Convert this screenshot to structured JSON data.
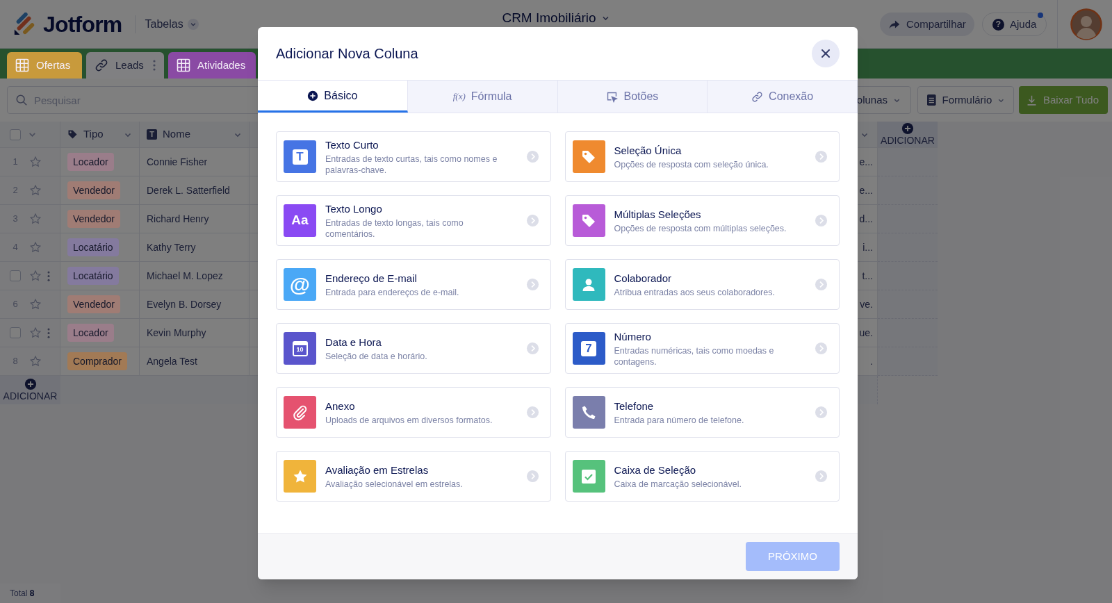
{
  "header": {
    "logo_text": "Jotform",
    "menu": "Tabelas",
    "title": "CRM Imobiliário",
    "share_button": "Compartilhar",
    "help_button": "Ajuda",
    "help_notification": true,
    "help_icon_text": "?"
  },
  "sheet_tabs": [
    {
      "label": "Ofertas",
      "color": "#c89a3c",
      "selected": false,
      "menu": false
    },
    {
      "label": "Leads",
      "color": "#808082",
      "selected": true,
      "menu": true
    },
    {
      "label": "Atividades",
      "color": "#8a4aa4",
      "selected": false,
      "menu": false
    }
  ],
  "toolbar": {
    "search": {
      "placeholder": "Pesquisar"
    },
    "buttons": [
      {
        "label": "olunas",
        "kind": "dropdown"
      },
      {
        "label": "Formulário",
        "kind": "form"
      },
      {
        "label": "Baixar Tudo",
        "kind": "download"
      }
    ]
  },
  "table": {
    "select_all_checked": false,
    "columns": [
      {
        "label": "Tipo",
        "kind": "tag"
      },
      {
        "label": "Nome",
        "kind": "text",
        "icon_text": "T"
      }
    ],
    "add_column": "ADICIONAR",
    "add_row": "ADICIONAR",
    "rows": [
      {
        "kind": "number",
        "number": "1",
        "starred": false,
        "tipo": {
          "label": "Locador",
          "color": "#9a7d8a"
        },
        "nome": "Connie Fisher",
        "column_4": "e..."
      },
      {
        "kind": "number",
        "number": "2",
        "starred": false,
        "tipo": {
          "label": "Vendedor",
          "color": "#a07c74"
        },
        "nome": "Derek L. Satterfield",
        "column_4": "e..."
      },
      {
        "kind": "number",
        "number": "3",
        "starred": false,
        "tipo": {
          "label": "Vendedor",
          "color": "#a07c74"
        },
        "nome": "Richard Henry",
        "column_4": "d..."
      },
      {
        "kind": "number",
        "number": "4",
        "starred": false,
        "tipo": {
          "label": "Locatário",
          "color": "#847a9e"
        },
        "nome": "Kathy Terry",
        "column_4": "i..."
      },
      {
        "kind": "checkbox",
        "checked": false,
        "starred": false,
        "tipo": {
          "label": "Locatário",
          "color": "#847a9e"
        },
        "nome": "Michael M. Lopez",
        "column_4": "t..."
      },
      {
        "kind": "number",
        "number": "6",
        "starred": false,
        "tipo": {
          "label": "Vendedor",
          "color": "#a07c74"
        },
        "nome": "Evelyn B. Dorsey",
        "column_4": "ve."
      },
      {
        "kind": "checkbox",
        "checked": false,
        "starred": false,
        "tipo": {
          "label": "Locador",
          "color": "#9a7d8a"
        },
        "nome": "Kevin Murphy",
        "column_4": "ue."
      },
      {
        "kind": "number",
        "number": "8",
        "starred": false,
        "tipo": {
          "label": "Comprador",
          "color": "#a27a55"
        },
        "nome": "Angela Test",
        "column_4": "."
      }
    ]
  },
  "footer": {
    "label": "Total",
    "count": "8"
  },
  "modal": {
    "title": "Adicionar Nova Coluna",
    "tabs": [
      {
        "label": "Básico",
        "selected": true
      },
      {
        "label": "Fórmula",
        "selected": false,
        "icon_text": "f(x)"
      },
      {
        "label": "Botões",
        "selected": false
      },
      {
        "label": "Conexão",
        "selected": false
      }
    ],
    "fields": [
      {
        "title": "Texto Curto",
        "description": "Entradas de texto curtas, tais como nomes e palavras-chave.",
        "color": "#4674e4",
        "icon_text": "T"
      },
      {
        "title": "Seleção Única",
        "description": "Opções de resposta com seleção única.",
        "color": "#ef8a2f"
      },
      {
        "title": "Texto Longo",
        "description": "Entradas de texto longas, tais como comentários.",
        "color": "#8a4af3",
        "icon_text": "Aa"
      },
      {
        "title": "Múltiplas Seleções",
        "description": "Opções de resposta com múltiplas seleções.",
        "color": "#b85bd8"
      },
      {
        "title": "Endereço de E-mail",
        "description": "Entrada para endereços de e-mail.",
        "color": "#4aa8f6",
        "icon_text": "@"
      },
      {
        "title": "Colaborador",
        "description": "Atribua entradas aos seus colaboradores.",
        "color": "#2fb9bd"
      },
      {
        "title": "Data e Hora",
        "description": "Seleção de data e horário.",
        "color": "#5a55cc",
        "icon_text": "10"
      },
      {
        "title": "Número",
        "description": "Entradas numéricas, tais como moedas e contagens.",
        "color": "#2c5bc8",
        "icon_text": "7"
      },
      {
        "title": "Anexo",
        "description": "Uploads de arquivos em diversos formatos.",
        "color": "#e5526f"
      },
      {
        "title": "Telefone",
        "description": "Entrada para número de telefone.",
        "color": "#7a7eac"
      },
      {
        "title": "Avaliação em Estrelas",
        "description": "Avaliação selecionável em estrelas.",
        "color": "#f0b43b"
      },
      {
        "title": "Caixa de Seleção",
        "description": "Caixa de marcação selecionável.",
        "color": "#56c27c"
      }
    ],
    "next_button": {
      "label": "PRÓXIMO",
      "disabled": true
    }
  }
}
